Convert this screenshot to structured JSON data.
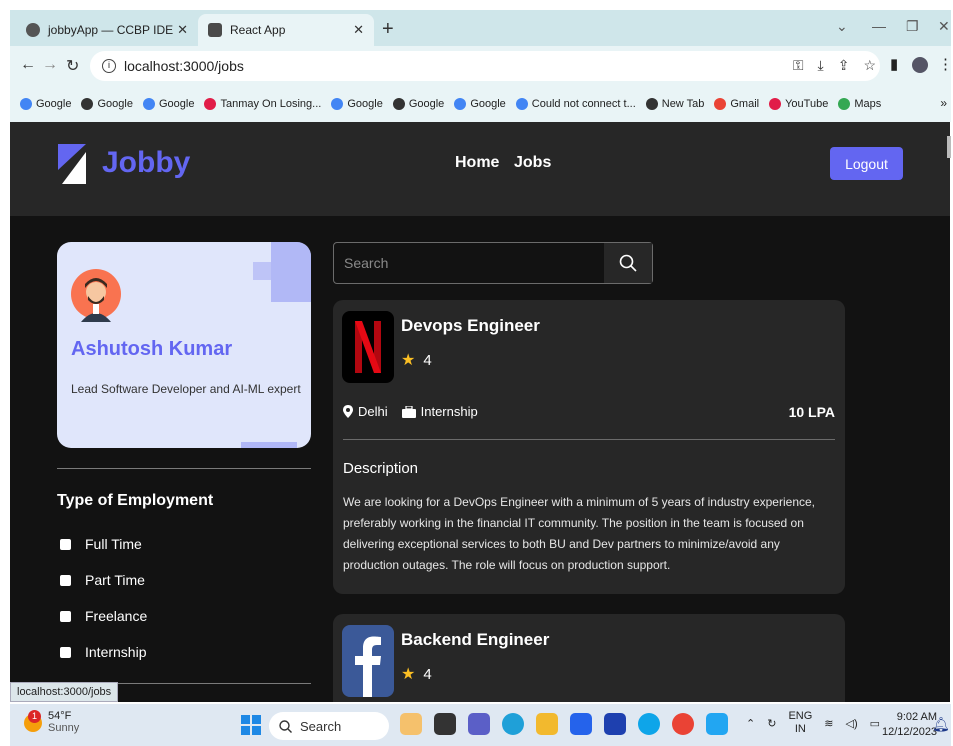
{
  "browser": {
    "tabs": [
      {
        "label": "jobbyApp — CCBP IDE",
        "active": false
      },
      {
        "label": "React App",
        "active": true
      }
    ],
    "url": "localhost:3000/jobs",
    "bookmarks": [
      {
        "label": "Google",
        "icon": "google-icon",
        "color": "#4285f4"
      },
      {
        "label": "Google",
        "icon": "globe-icon",
        "color": "#333333"
      },
      {
        "label": "Google",
        "icon": "google-icon",
        "color": "#4285f4"
      },
      {
        "label": "Tanmay On Losing...",
        "icon": "youtube-icon",
        "color": "#e11d48"
      },
      {
        "label": "Google",
        "icon": "google-icon",
        "color": "#4285f4"
      },
      {
        "label": "Google",
        "icon": "globe-icon",
        "color": "#333333"
      },
      {
        "label": "Google",
        "icon": "google-icon",
        "color": "#4285f4"
      },
      {
        "label": "Could not connect t...",
        "icon": "google-icon",
        "color": "#4285f4"
      },
      {
        "label": "New Tab",
        "icon": "globe-icon",
        "color": "#333333"
      },
      {
        "label": "Gmail",
        "icon": "gmail-icon",
        "color": "#ea4335"
      },
      {
        "label": "YouTube",
        "icon": "youtube-icon",
        "color": "#e11d48"
      },
      {
        "label": "Maps",
        "icon": "maps-icon",
        "color": "#34a853"
      }
    ],
    "status_url": "localhost:3000/jobs"
  },
  "header": {
    "logo_text": "Jobby",
    "nav": [
      "Home",
      "Jobs"
    ],
    "logout_label": "Logout",
    "accent": "#6366f1"
  },
  "profile": {
    "name": "Ashutosh Kumar",
    "bio": "Lead Software Developer and AI-ML expert"
  },
  "filters": {
    "title": "Type of Employment",
    "options": [
      "Full Time",
      "Part Time",
      "Freelance",
      "Internship"
    ]
  },
  "search": {
    "placeholder": "Search"
  },
  "jobs": [
    {
      "title": "Devops Engineer",
      "rating": "4",
      "location": "Delhi",
      "employment_type": "Internship",
      "package": "10 LPA",
      "description_title": "Description",
      "description": "We are looking for a DevOps Engineer with a minimum of 5 years of industry experience, preferably working in the financial IT community. The position in the team is focused on delivering exceptional services to both BU and Dev partners to minimize/avoid any production outages. The role will focus on production support.",
      "logo": "netflix-logo"
    },
    {
      "title": "Backend Engineer",
      "rating": "4",
      "logo": "facebook-logo"
    }
  ],
  "taskbar": {
    "weather_temp": "54°F",
    "weather_desc": "Sunny",
    "weather_badge": "1",
    "search_label": "Search",
    "lang": "ENG",
    "region": "IN",
    "time": "9:02 AM",
    "date": "12/12/2023"
  }
}
